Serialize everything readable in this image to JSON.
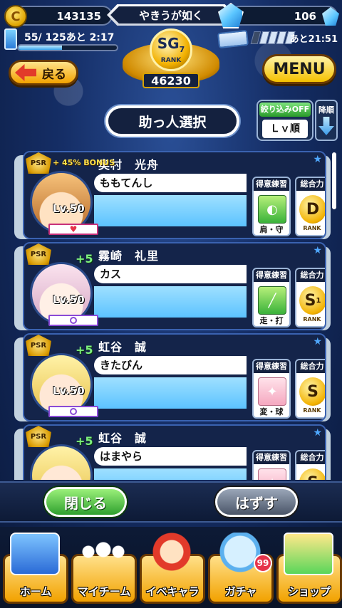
{
  "header": {
    "coins": "143135",
    "title": "やきうが如く",
    "gems": "106",
    "stamina_text": "55/ 125あと  2:17",
    "stamina_fraction": 0.44,
    "ticket_time": "あと21:51",
    "rank_grade": "SG",
    "rank_grade_sub": "7",
    "rank_label": "RANK",
    "rank_score": "46230",
    "back_label": "戻る",
    "menu_label": "MENU"
  },
  "page": {
    "title": "助っ人選択",
    "filter_label": "絞り込みOFF",
    "filter_value": "Ｌｖ順",
    "sort_label": "降順"
  },
  "cards": [
    {
      "name": "奥村　光舟",
      "nickname": "ももてんし",
      "level": "Lv.50",
      "psr": "PSR",
      "bonus": "+ 45% BONUS",
      "plus": "",
      "skill_title": "得意練習",
      "skill_text": "肩・守",
      "rank_title": "総合力",
      "rank_letter": "D",
      "rank_letter_sub": "",
      "rank_sub": "RANK",
      "status": "heart"
    },
    {
      "name": "霧崎　礼里",
      "nickname": "カス",
      "level": "Lv.50",
      "psr": "PSR",
      "bonus": "",
      "plus": "+5",
      "skill_title": "得意練習",
      "skill_text": "走・打",
      "rank_title": "総合力",
      "rank_letter": "S",
      "rank_letter_sub": "1",
      "rank_sub": "RANK",
      "status": "circle"
    },
    {
      "name": "虹谷　誠",
      "nickname": "きたびん",
      "level": "Lv.50",
      "psr": "PSR",
      "bonus": "",
      "plus": "+5",
      "skill_title": "得意練習",
      "skill_text": "変・球",
      "rank_title": "総合力",
      "rank_letter": "S",
      "rank_letter_sub": "",
      "rank_sub": "RANK",
      "status": "circle"
    },
    {
      "name": "虹谷　誠",
      "nickname": "はまやら",
      "level": "",
      "psr": "PSR",
      "bonus": "",
      "plus": "+5",
      "skill_title": "得意練習",
      "skill_text": "",
      "rank_title": "総合力",
      "rank_letter": "S",
      "rank_letter_sub": "",
      "rank_sub": "",
      "status": "circle"
    }
  ],
  "actions": {
    "close_label": "閉じる",
    "remove_label": "はずす"
  },
  "nav": {
    "items": [
      {
        "label": "ホーム"
      },
      {
        "label": "マイチーム"
      },
      {
        "label": "イベキャラ"
      },
      {
        "label": "ガチャ"
      },
      {
        "label": "ショップ"
      }
    ],
    "gacha_badge": "99"
  },
  "colors": {
    "background": "#152e66",
    "card_body": "#5cc3ff",
    "close_button": "#2ea02e",
    "remove_button": "#4a5568",
    "nav_item": "#f2a200"
  }
}
